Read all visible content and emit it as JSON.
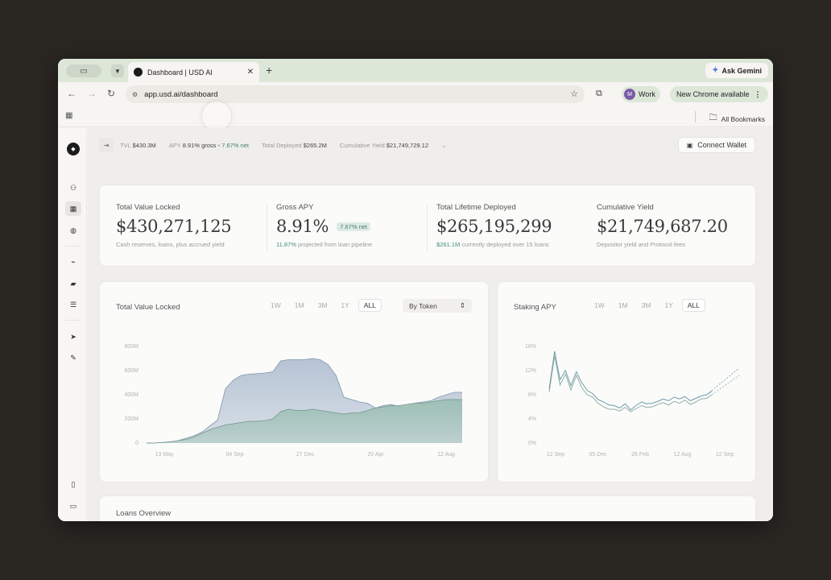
{
  "browser": {
    "tab_title": "Dashboard | USD AI",
    "url": "app.usd.ai/dashboard",
    "ask_gemini": "Ask Gemini",
    "profile_label": "Work",
    "profile_initial": "M",
    "update_label": "New Chrome available",
    "all_bookmarks": "All Bookmarks"
  },
  "topbar": {
    "stats": [
      {
        "label": "TVL",
        "value": "$430.3M"
      },
      {
        "label": "APY",
        "value": "8.91% gross",
        "extra": "7.67% net"
      },
      {
        "label": "Total Deployed",
        "value": "$265.2M"
      },
      {
        "label": "Cumulative Yield",
        "value": "$21,749,729.12"
      }
    ],
    "connect_wallet": "Connect Wallet"
  },
  "kpis": [
    {
      "title": "Total Value Locked",
      "value": "$430,271,125",
      "sub_pre": "",
      "sub_hl": "",
      "sub": "Cash reserves, loans, plus accrued yield"
    },
    {
      "title": "Gross APY",
      "value": "8.91%",
      "badge": "7.67% net",
      "sub_pre": "",
      "sub_hl": "11.87%",
      "sub": " projected from loan pipeline"
    },
    {
      "title": "Total Lifetime Deployed",
      "value": "$265,195,299",
      "sub_hl": "$261.1M",
      "sub": " currently deployed over 15 loans"
    },
    {
      "title": "Cumulative Yield",
      "value": "$21,749,687.20",
      "sub_hl": "",
      "sub": "Depositor yield and Protocol fees"
    }
  ],
  "tvl_card": {
    "title": "Total Value Locked",
    "ranges": [
      "1W",
      "1M",
      "3M",
      "1Y",
      "ALL"
    ],
    "active_range": "ALL",
    "select_value": "By Token"
  },
  "apy_card": {
    "title": "Staking APY",
    "ranges": [
      "1W",
      "1M",
      "3M",
      "1Y",
      "ALL"
    ],
    "active_range": "ALL"
  },
  "loans": {
    "title": "Loans Overview"
  },
  "colors": {
    "accent": "#3f7f6e",
    "tvl_upper": "#aebdd0",
    "tvl_lower": "#9cbfb4"
  },
  "chart_data": [
    {
      "type": "area",
      "title": "Total Value Locked",
      "y_ticks": [
        "800M",
        "600M",
        "400M",
        "200M",
        "0"
      ],
      "x_ticks": [
        "13 May",
        "04 Sep",
        "27 Dec",
        "20 Apr",
        "12 Aug"
      ],
      "ylim": [
        0,
        800
      ],
      "x": [
        0,
        1,
        2,
        3,
        4,
        5,
        6,
        7,
        8,
        9,
        10,
        11,
        12,
        13,
        14,
        15,
        16,
        17,
        18,
        19,
        20,
        21,
        22,
        23,
        24,
        25,
        26,
        27,
        28,
        29,
        30,
        31,
        32,
        33,
        34,
        35,
        36,
        37,
        38,
        39,
        40
      ],
      "series": [
        {
          "values": [
            0,
            0,
            5,
            10,
            20,
            40,
            60,
            90,
            140,
            190,
            450,
            520,
            560,
            570,
            575,
            580,
            590,
            680,
            690,
            690,
            690,
            700,
            690,
            650,
            560,
            380,
            360,
            340,
            330,
            290,
            310,
            320,
            300,
            290,
            330,
            340,
            350,
            380,
            400,
            420,
            420
          ]
        },
        {
          "values": [
            0,
            0,
            5,
            10,
            20,
            30,
            50,
            80,
            110,
            130,
            150,
            160,
            170,
            180,
            180,
            185,
            200,
            260,
            280,
            270,
            270,
            280,
            270,
            260,
            250,
            240,
            250,
            250,
            270,
            290,
            300,
            310,
            310,
            320,
            330,
            330,
            340,
            350,
            360,
            360,
            360
          ]
        }
      ]
    },
    {
      "type": "line",
      "title": "Staking APY",
      "y_ticks": [
        "16%",
        "12%",
        "8%",
        "4%",
        "0%"
      ],
      "x_ticks": [
        "12 Sep",
        "05 Dec",
        "26 Feb",
        "12 Aug",
        "12 Sep"
      ],
      "ylim": [
        0,
        16
      ],
      "x": [
        0,
        1,
        2,
        3,
        4,
        5,
        6,
        7,
        8,
        9,
        10,
        11,
        12,
        13,
        14,
        15,
        16,
        17,
        18,
        19,
        20,
        21,
        22,
        23,
        24,
        25,
        26,
        27,
        28,
        29,
        30
      ],
      "series": [
        {
          "values": [
            9,
            15.2,
            10.5,
            12,
            9.5,
            11.8,
            10,
            8.7,
            8.2,
            7.2,
            6.8,
            6.3,
            6.2,
            5.8,
            6.5,
            5.5,
            6.2,
            6.8,
            6.5,
            6.6,
            6.9,
            7.3,
            7.0,
            7.6,
            7.3,
            7.7,
            7.0,
            7.4,
            7.8,
            8.0,
            8.6
          ]
        },
        {
          "values": [
            8.4,
            14.4,
            9.6,
            11.4,
            8.8,
            11.2,
            9.2,
            8.0,
            7.6,
            6.6,
            6.0,
            5.6,
            5.6,
            5.3,
            5.9,
            5.2,
            5.7,
            6.2,
            5.9,
            6.0,
            6.4,
            6.7,
            6.3,
            6.9,
            6.6,
            7.1,
            6.4,
            6.8,
            7.3,
            7.4,
            8.0
          ]
        }
      ],
      "projections": [
        {
          "from": [
            29,
            8.0
          ],
          "to": [
            35,
            12.4
          ]
        },
        {
          "from": [
            29,
            7.4
          ],
          "to": [
            35,
            11.2
          ]
        }
      ]
    }
  ]
}
